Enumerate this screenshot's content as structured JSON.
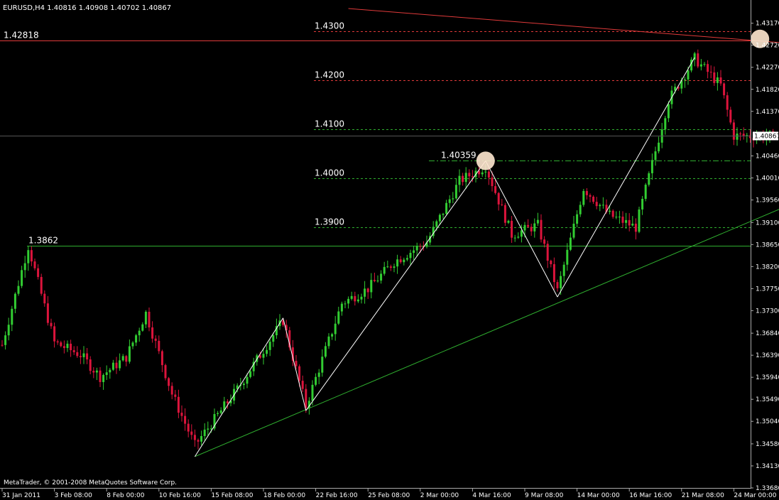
{
  "window": {
    "header": "EURUSD,H4  1.40816 1.40908 1.40702 1.40867",
    "copyright": "MetaTrader, © 2001-2008 MetaQuotes Software Corp."
  },
  "colors": {
    "background": "#000000",
    "bull": "#32cd32",
    "bear": "#dc143c",
    "red_line": "#e03a3a",
    "green_line": "#2fae2f",
    "zigzag": "#ffffff",
    "marker": "#ffe8d0"
  },
  "chart_data": {
    "type": "candlestick",
    "symbol": "EURUSD",
    "timeframe": "H4",
    "ylim": [
      1.3368,
      1.4347
    ],
    "y_ticks": [
      "1.43170",
      "1.42720",
      "1.42270",
      "1.41820",
      "1.41370",
      "1.40867",
      "1.40460",
      "1.40010",
      "1.39560",
      "1.39100",
      "1.38650",
      "1.38200",
      "1.37750",
      "1.37300",
      "1.36840",
      "1.36390",
      "1.35940",
      "1.35490",
      "1.35040",
      "1.34580",
      "1.34130",
      "1.33680"
    ],
    "y_tick_values": [
      1.4317,
      1.4272,
      1.4227,
      1.4182,
      1.4137,
      1.40867,
      1.4046,
      1.4001,
      1.3956,
      1.391,
      1.3865,
      1.382,
      1.3775,
      1.373,
      1.3684,
      1.3639,
      1.3594,
      1.3549,
      1.3504,
      1.3458,
      1.3413,
      1.3368
    ],
    "current_price": "1.40867",
    "current_price_value": 1.40867,
    "x_ticks": [
      "31 Jan 2011",
      "3 Feb 08:00",
      "8 Feb 00:00",
      "10 Feb 16:00",
      "15 Feb 08:00",
      "18 Feb 00:00",
      "22 Feb 16:00",
      "25 Feb 08:00",
      "2 Mar 00:00",
      "4 Mar 16:00",
      "9 Mar 08:00",
      "14 Mar 00:00",
      "16 Mar 16:00",
      "21 Mar 08:00",
      "24 Mar 00:00"
    ],
    "x_tick_index": [
      0,
      16,
      32,
      48,
      64,
      80,
      96,
      112,
      128,
      144,
      160,
      176,
      192,
      208,
      224
    ],
    "n_bars": 237,
    "horizontal_levels": [
      {
        "label": "1.4300",
        "value": 1.43,
        "style": "red-dashed"
      },
      {
        "label": "1.42818",
        "value": 1.42818,
        "style": "red-solid"
      },
      {
        "label": "1.4200",
        "value": 1.42,
        "style": "red-dashed"
      },
      {
        "label": "1.4100",
        "value": 1.41,
        "style": "green-dashed"
      },
      {
        "label": "1.40359",
        "value": 1.40359,
        "style": "green-dashdot"
      },
      {
        "label": "1.4000",
        "value": 1.4,
        "style": "green-dashed"
      },
      {
        "label": "1.3900",
        "value": 1.39,
        "style": "green-dashed"
      },
      {
        "label": "1.3862",
        "value": 1.3862,
        "style": "green-solid"
      }
    ],
    "trendlines": [
      {
        "color": "red",
        "from": [
          106,
          1.4347
        ],
        "to": [
          262,
          1.4265
        ]
      },
      {
        "color": "green",
        "from": [
          59,
          1.3432
        ],
        "to": [
          262,
          1.4005
        ]
      }
    ],
    "zigzag": [
      [
        59,
        1.3432
      ],
      [
        86,
        1.3715
      ],
      [
        93,
        1.3526
      ],
      [
        148,
        1.4036
      ],
      [
        170,
        1.3758
      ],
      [
        212,
        1.4247
      ]
    ],
    "markers": [
      [
        148,
        1.4036
      ],
      [
        232,
        1.4285
      ]
    ],
    "anchors": [
      [
        0,
        1.366
      ],
      [
        8,
        1.3862
      ],
      [
        16,
        1.3665
      ],
      [
        24,
        1.364
      ],
      [
        30,
        1.3595
      ],
      [
        38,
        1.3635
      ],
      [
        44,
        1.3725
      ],
      [
        52,
        1.356
      ],
      [
        59,
        1.3455
      ],
      [
        72,
        1.357
      ],
      [
        86,
        1.371
      ],
      [
        93,
        1.3535
      ],
      [
        104,
        1.3745
      ],
      [
        112,
        1.3775
      ],
      [
        120,
        1.383
      ],
      [
        130,
        1.387
      ],
      [
        140,
        1.3995
      ],
      [
        148,
        1.4025
      ],
      [
        156,
        1.3885
      ],
      [
        164,
        1.3905
      ],
      [
        170,
        1.377
      ],
      [
        178,
        1.398
      ],
      [
        186,
        1.3925
      ],
      [
        194,
        1.39
      ],
      [
        204,
        1.416
      ],
      [
        212,
        1.4245
      ],
      [
        220,
        1.419
      ],
      [
        224,
        1.4087
      ]
    ]
  }
}
